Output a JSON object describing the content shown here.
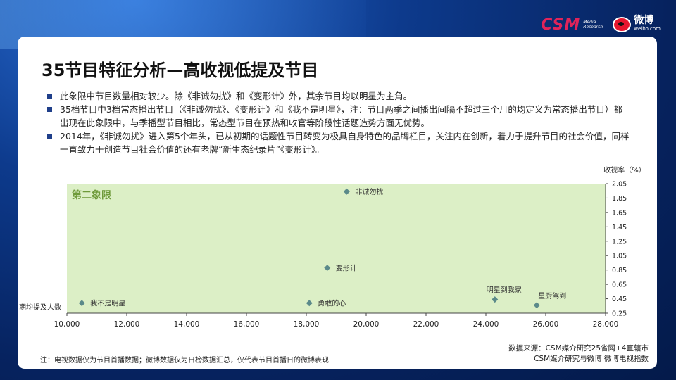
{
  "logos": {
    "csm_text": "CSM",
    "csm_sub_1": "Media",
    "csm_sub_2": "Research",
    "weibo_cn": "微博",
    "weibo_url": "weibo.com"
  },
  "title": "35节目特征分析—高收视低提及节目",
  "bullets": [
    "此象限中节目数量相对较少。除《非诚勿扰》和《变形计》外，其余节目均以明星为主角。",
    "35档节目中3档常态播出节目（《非诚勿扰》、《变形计》和《我不是明星》，注：节目两季之间播出间隔不超过三个月的均定义为常态播出节目）都出现在此象限中，与季播型节目相比，常态型节目在预热和收官等阶段性话题造势方面无优势。",
    "2014年，《非诚勿扰》进入第5个年头，已从初期的话题性节目转变为极具自身特色的品牌栏目，关注内在创新，着力于提升节目的社会价值，同样一直致力于创造节目社会价值的还有老牌“新生态纪录片”《变形计》。"
  ],
  "chart_data": {
    "type": "scatter",
    "quadrant_label": "第二象限",
    "xlabel": "期均提及人数",
    "ylabel": "收视率（%）",
    "xlim": [
      10000,
      28000
    ],
    "ylim": [
      0.25,
      2.05
    ],
    "x_ticks": [
      "10,000",
      "12,000",
      "14,000",
      "16,000",
      "18,000",
      "20,000",
      "22,000",
      "24,000",
      "26,000",
      "28,000"
    ],
    "x_tick_values": [
      10000,
      12000,
      14000,
      16000,
      18000,
      20000,
      22000,
      24000,
      26000,
      28000
    ],
    "y_ticks": [
      "2.05",
      "1.85",
      "1.65",
      "1.45",
      "1.25",
      "1.05",
      "0.85",
      "0.65",
      "0.45",
      "0.25"
    ],
    "y_tick_values": [
      2.05,
      1.85,
      1.65,
      1.45,
      1.25,
      1.05,
      0.85,
      0.65,
      0.45,
      0.25
    ],
    "points": [
      {
        "label": "非诚勿扰",
        "x": 19350,
        "y": 1.94
      },
      {
        "label": "变形计",
        "x": 18700,
        "y": 0.88
      },
      {
        "label": "我不是明星",
        "x": 10500,
        "y": 0.39
      },
      {
        "label": "勇敢的心",
        "x": 18100,
        "y": 0.39
      },
      {
        "label": "明星到我家",
        "x": 24300,
        "y": 0.44
      },
      {
        "label": "星厨驾到",
        "x": 25700,
        "y": 0.36
      }
    ],
    "colors": {
      "plot_bg": "#dcefc6",
      "marker": "#5b8a8a",
      "quadrant_label": "#6e9a3a"
    }
  },
  "footnote": "注：电视数据仅为节目首播数据；微博数据仅为日榜数据汇总，仅代表节目首播日的微博表现",
  "source_lines": [
    "数据来源：CSM媒介研究25省网+4直辖市",
    "CSM媒介研究与微博 微博电视指数"
  ]
}
